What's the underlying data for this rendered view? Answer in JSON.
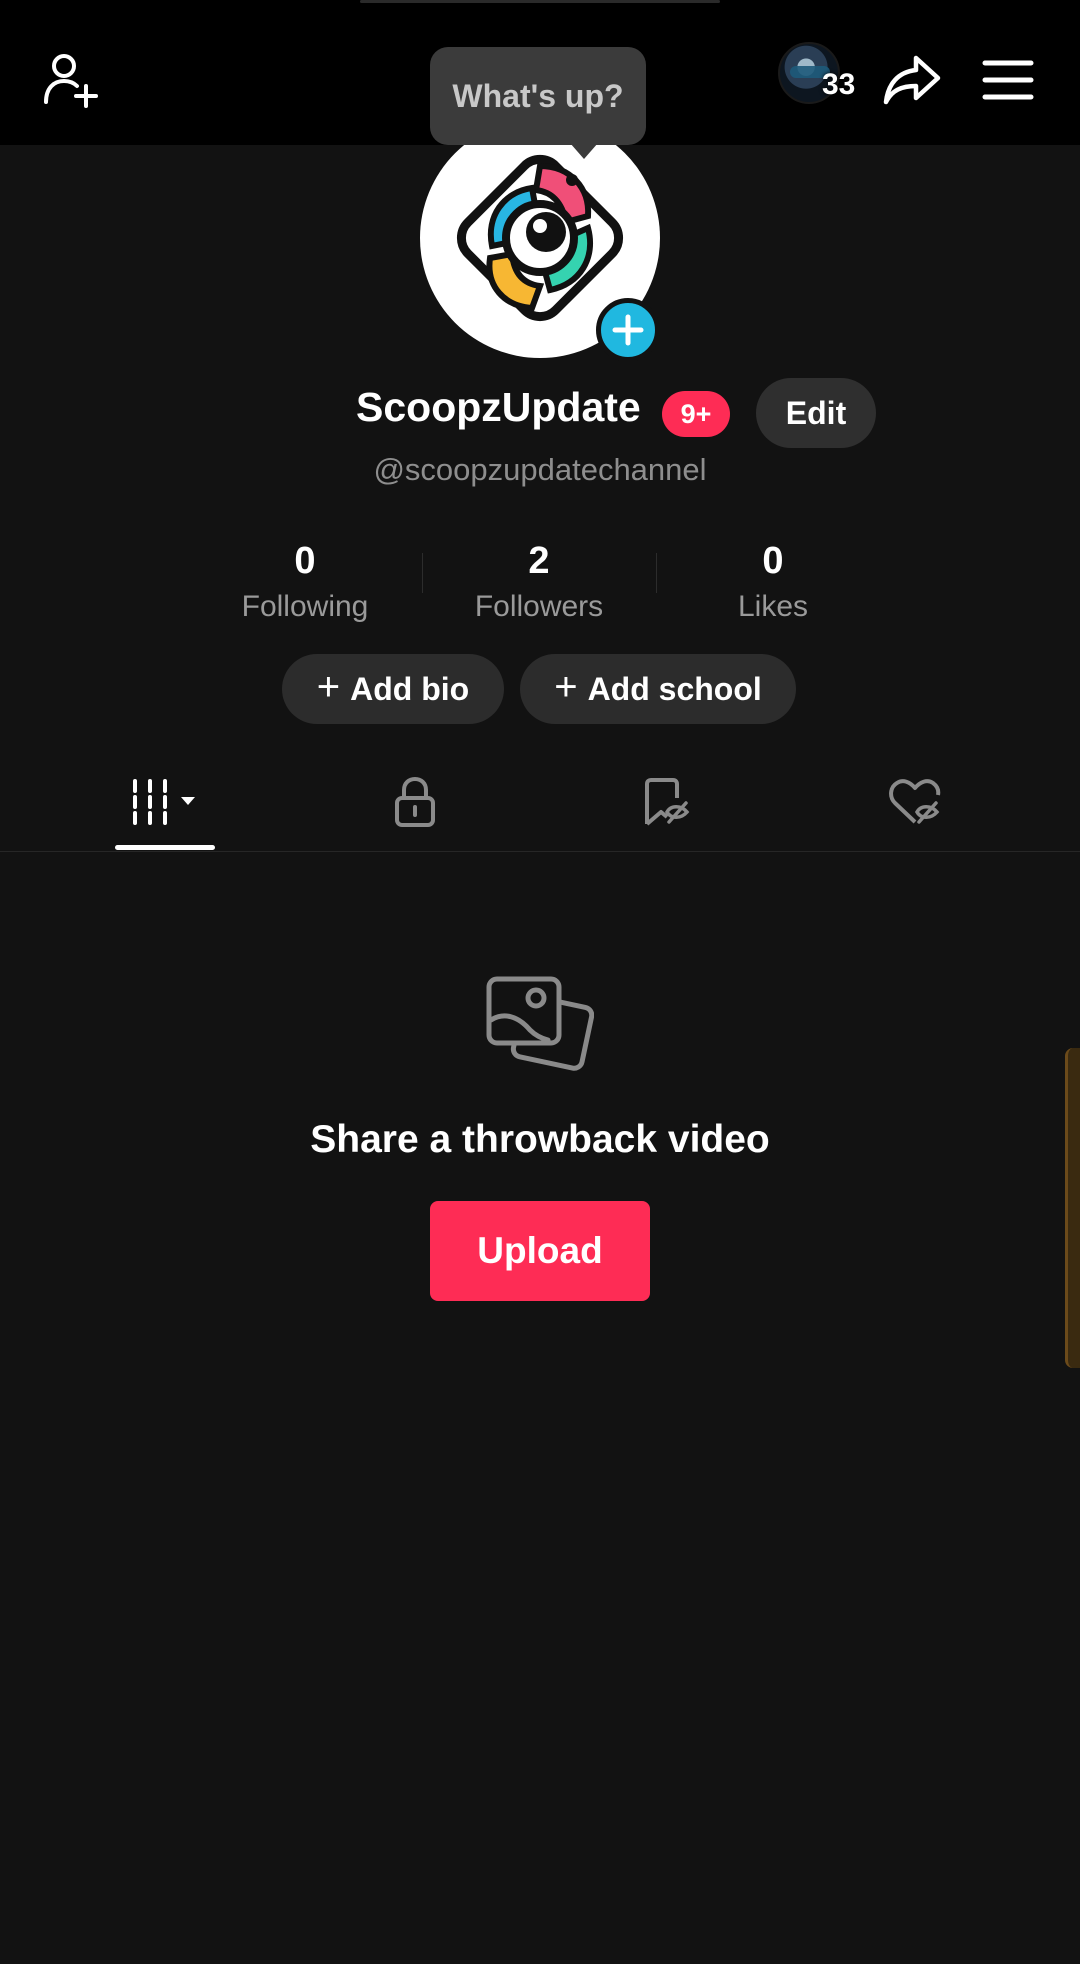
{
  "header": {
    "bubble_text": "What's up?",
    "viewer_count": "33",
    "icons": [
      "add-friend-icon",
      "share-icon",
      "menu-icon"
    ]
  },
  "profile": {
    "display_name": "ScoopzUpdate",
    "notification_badge": "9+",
    "edit_label": "Edit",
    "handle": "@scoopzupdatechannel"
  },
  "stats": [
    {
      "value": "0",
      "label": "Following"
    },
    {
      "value": "2",
      "label": "Followers"
    },
    {
      "value": "0",
      "label": "Likes"
    }
  ],
  "actions": {
    "add_bio": "Add bio",
    "add_school": "Add school"
  },
  "tabs": [
    {
      "icon": "grid-icon",
      "active": true
    },
    {
      "icon": "lock-icon",
      "active": false
    },
    {
      "icon": "bookmark-icon",
      "active": false
    },
    {
      "icon": "liked-icon",
      "active": false
    }
  ],
  "empty_state": {
    "icon": "photos-icon",
    "title": "Share a throwback video",
    "button": "Upload"
  },
  "colors": {
    "background": "#121212",
    "accent": "#fe2c55",
    "add_avatar": "#20b8e0"
  }
}
